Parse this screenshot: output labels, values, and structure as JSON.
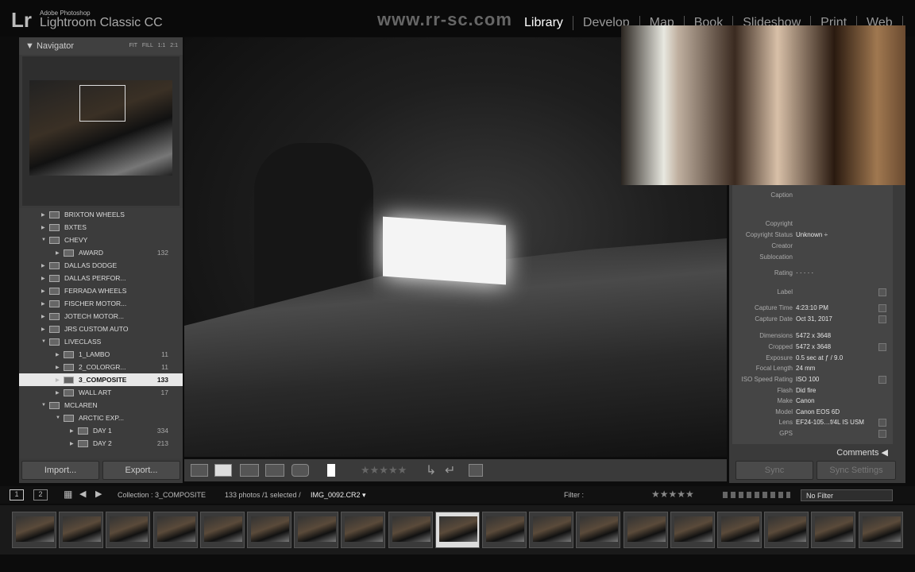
{
  "app": {
    "logo": "Lr",
    "brand_top": "Adobe Photoshop",
    "brand_main": "Lightroom Classic CC",
    "watermark": "www.rr-sc.com"
  },
  "modules": [
    {
      "label": "Library",
      "active": true
    },
    {
      "label": "Develop"
    },
    {
      "label": "Map"
    },
    {
      "label": "Book"
    },
    {
      "label": "Slideshow"
    },
    {
      "label": "Print"
    },
    {
      "label": "Web"
    }
  ],
  "navigator": {
    "title": "Navigator",
    "options": "FIT FILL 1:1 2:1"
  },
  "folders": [
    {
      "name": "BRIXTON WHEELS",
      "level": 0,
      "open": false
    },
    {
      "name": "BXTES",
      "level": 0,
      "open": false
    },
    {
      "name": "CHEVY",
      "level": 0,
      "open": true
    },
    {
      "name": "AWARD",
      "level": 1,
      "count": "132"
    },
    {
      "name": "DALLAS DODGE",
      "level": 0
    },
    {
      "name": "DALLAS PERFOR...",
      "level": 0
    },
    {
      "name": "FERRADA WHEELS",
      "level": 0
    },
    {
      "name": "FISCHER MOTOR...",
      "level": 0
    },
    {
      "name": "JOTECH MOTOR...",
      "level": 0
    },
    {
      "name": "JRS CUSTOM AUTO",
      "level": 0
    },
    {
      "name": "LIVECLASS",
      "level": 0,
      "open": true
    },
    {
      "name": "1_LAMBO",
      "level": 1,
      "count": "11"
    },
    {
      "name": "2_COLORGR...",
      "level": 1,
      "count": "11"
    },
    {
      "name": "3_COMPOSITE",
      "level": 1,
      "count": "133",
      "selected": true
    },
    {
      "name": "WALL ART",
      "level": 1,
      "count": "17"
    },
    {
      "name": "MCLAREN",
      "level": 0,
      "open": true
    },
    {
      "name": "ARCTIC EXP...",
      "level": 1,
      "open": true
    },
    {
      "name": "DAY 1",
      "level": 2,
      "count": "334"
    },
    {
      "name": "DAY 2",
      "level": 2,
      "count": "213"
    }
  ],
  "left_buttons": {
    "import": "Import...",
    "export": "Export..."
  },
  "metadata": [
    {
      "k": "Caption",
      "v": ""
    },
    {
      "k": "Copyright",
      "v": ""
    },
    {
      "k": "Copyright Status",
      "v": "Unknown ÷"
    },
    {
      "k": "Creator",
      "v": ""
    },
    {
      "k": "Sublocation",
      "v": ""
    },
    {
      "k": "Rating",
      "v": "·  ·  ·  ·  ·"
    },
    {
      "k": "Label",
      "v": "",
      "btn": true
    },
    {
      "k": "Capture Time",
      "v": "4:23:10 PM",
      "btn": true
    },
    {
      "k": "Capture Date",
      "v": "Oct 31, 2017",
      "btn": true
    },
    {
      "k": "Dimensions",
      "v": "5472 x 3648"
    },
    {
      "k": "Cropped",
      "v": "5472 x 3648",
      "btn": true
    },
    {
      "k": "Exposure",
      "v": "0.5 sec at ƒ / 9.0"
    },
    {
      "k": "Focal Length",
      "v": "24 mm"
    },
    {
      "k": "ISO Speed Rating",
      "v": "ISO 100",
      "btn": true
    },
    {
      "k": "Flash",
      "v": "Did fire"
    },
    {
      "k": "Make",
      "v": "Canon"
    },
    {
      "k": "Model",
      "v": "Canon EOS 6D"
    },
    {
      "k": "Lens",
      "v": "EF24-105…f/4L IS USM",
      "btn": true
    },
    {
      "k": "GPS",
      "v": "",
      "btn": true
    }
  ],
  "right_panel": {
    "comments": "Comments ◀",
    "sync": "Sync",
    "sync_settings": "Sync Settings"
  },
  "filmstrip_bar": {
    "screen1": "1",
    "screen2": "2",
    "collection": "Collection : 3_COMPOSITE",
    "info": "133 photos /1 selected /",
    "filename": "IMG_0092.CR2 ▾",
    "filter_label": "Filter :",
    "filter_value": "No Filter",
    "stars": "★★★★★"
  },
  "filmstrip": {
    "count": 19,
    "selected_index": 9
  }
}
